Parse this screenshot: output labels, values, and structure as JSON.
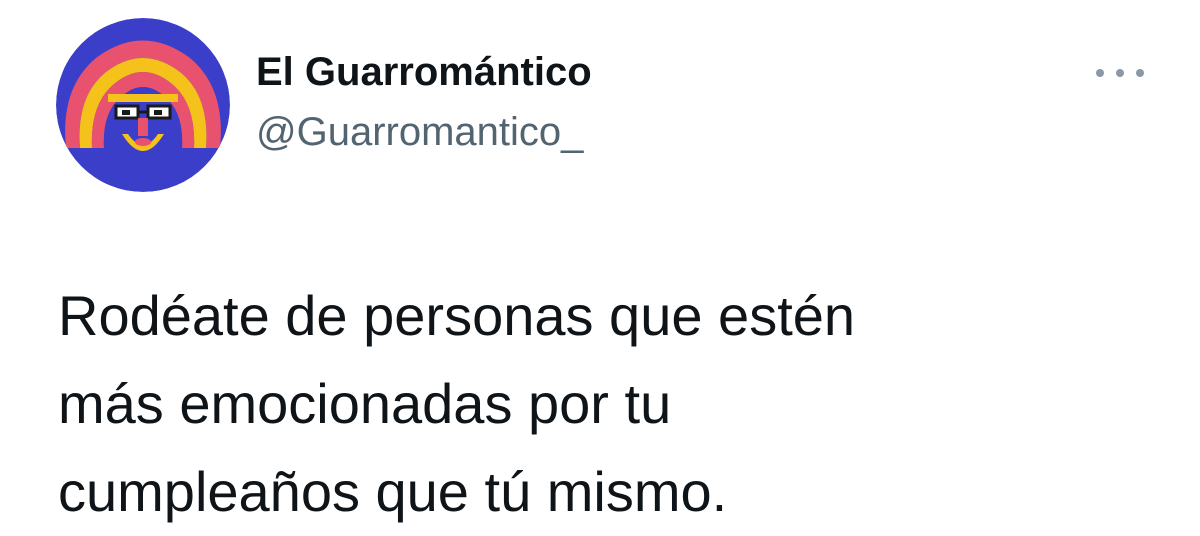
{
  "author": {
    "display_name": "El Guarromántico",
    "handle": "@Guarromantico_",
    "avatar_icon": "illustrated-bearded-face-icon"
  },
  "more_icon": "more-options-icon",
  "tweet": {
    "lines": [
      "Rodéate de personas que estén",
      "más emocionadas por tu",
      "cumpleaños que tú mismo."
    ]
  },
  "colors": {
    "avatar_blue": "#3b3ec9",
    "avatar_pink": "#e8526e",
    "avatar_yellow": "#f5c21b",
    "handle_gray": "#536471",
    "text": "#0f1419"
  }
}
